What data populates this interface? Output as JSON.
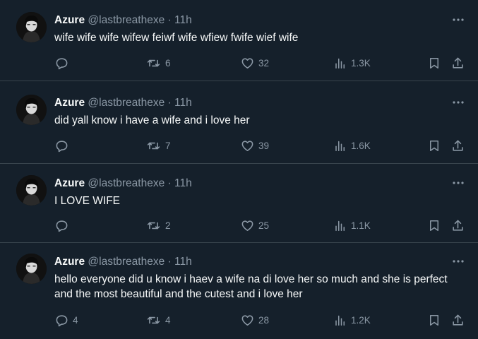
{
  "tweets": [
    {
      "name": "Azure",
      "handle": "@lastbreathexe",
      "separator": "·",
      "time": "11h",
      "text": "wife wife wife wifew feiwf wife wfiew fwife wief wife",
      "replies": "",
      "retweets": "6",
      "likes": "32",
      "views": "1.3K"
    },
    {
      "name": "Azure",
      "handle": "@lastbreathexe",
      "separator": "·",
      "time": "11h",
      "text": "did yall know i have a wife and i love her",
      "replies": "",
      "retweets": "7",
      "likes": "39",
      "views": "1.6K"
    },
    {
      "name": "Azure",
      "handle": "@lastbreathexe",
      "separator": "·",
      "time": "11h",
      "text": "I LOVE WIFE",
      "replies": "",
      "retweets": "2",
      "likes": "25",
      "views": "1.1K"
    },
    {
      "name": "Azure",
      "handle": "@lastbreathexe",
      "separator": "·",
      "time": "11h",
      "text": "hello everyone did u know i haev a wife na di love her so much and she is perfect and the most beautiful and the cutest and i love her",
      "replies": "4",
      "retweets": "4",
      "likes": "28",
      "views": "1.2K"
    }
  ],
  "icons": {
    "reply": "reply-icon",
    "retweet": "retweet-icon",
    "like": "heart-icon",
    "views": "views-icon",
    "bookmark": "bookmark-icon",
    "share": "share-icon",
    "more": "more-icon"
  },
  "colors": {
    "background": "#15202b",
    "text": "#f7f9f9",
    "muted": "#8b98a5",
    "divider": "#38444d"
  }
}
